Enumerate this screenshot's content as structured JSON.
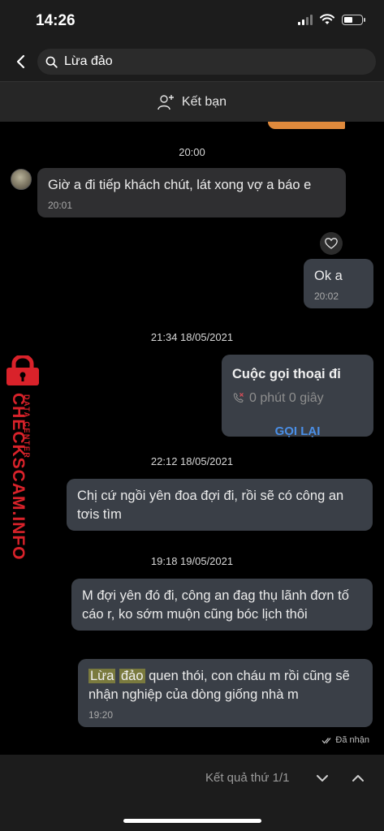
{
  "status": {
    "time": "14:26"
  },
  "header": {
    "search_value": "Lừa đảo",
    "add_friend_label": "Kết bạn"
  },
  "messages": [
    {
      "time_sep": "20:00"
    },
    {
      "text": "Giờ a đi tiếp khách chút, lát xong vợ a báo e",
      "time": "20:01"
    },
    {
      "text": "Ok a",
      "time": "20:02"
    },
    {
      "time_sep": "21:34 18/05/2021"
    },
    {
      "call_title": "Cuộc gọi thoại đi",
      "call_duration": "0 phút 0 giây",
      "call_back": "GỌI LẠI"
    },
    {
      "time_sep": "22:12 18/05/2021"
    },
    {
      "text": "Chị cứ ngồi yên đoa đợi đi, rồi sẽ có công an tơis tìm"
    },
    {
      "time_sep": "19:18 19/05/2021"
    },
    {
      "text": "M đợi yên đó đi, công an đag thụ lãnh đơn tố cáo r, ko sớm muộn cũng bóc lịch thôi"
    },
    {
      "hl1": "Lừa",
      "hl2": "đảo",
      "text_rest": " quen thói, con cháu m rồi cũng sẽ nhận nghiệp của dòng giống nhà m",
      "time": "19:20"
    }
  ],
  "seen_label": "Đã nhận",
  "watermark": {
    "main": "CHECKSCAM.INFO",
    "sub": "DATA CENTER"
  },
  "footer": {
    "result_label": "Kết quả thứ 1/1"
  }
}
